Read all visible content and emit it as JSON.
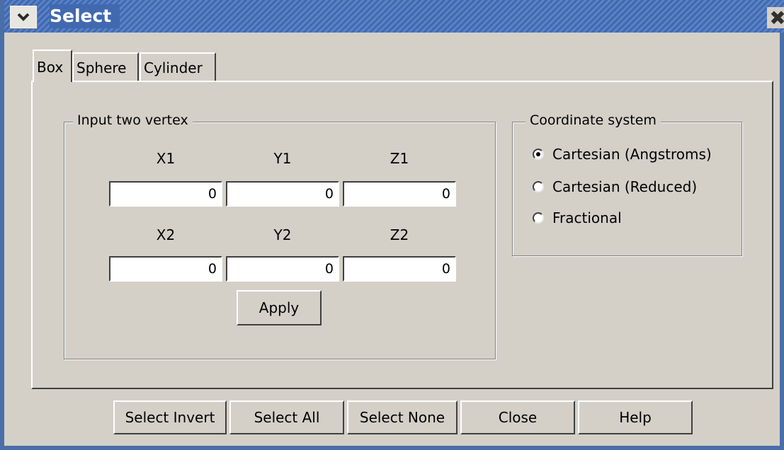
{
  "window": {
    "title": "Select",
    "menu_glyph": "❯",
    "close_glyph": "✖"
  },
  "tabs": [
    {
      "label": "Box",
      "active": true
    },
    {
      "label": "Sphere",
      "active": false
    },
    {
      "label": "Cylinder",
      "active": false
    }
  ],
  "vertex_group": {
    "legend": "Input two vertex",
    "row1_labels": [
      "X1",
      "Y1",
      "Z1"
    ],
    "row1_values": [
      "0",
      "0",
      "0"
    ],
    "row2_labels": [
      "X2",
      "Y2",
      "Z2"
    ],
    "row2_values": [
      "0",
      "0",
      "0"
    ],
    "apply_label": "Apply"
  },
  "coord_group": {
    "legend": "Coordinate system",
    "options": [
      {
        "label": "Cartesian (Angstroms)",
        "selected": true
      },
      {
        "label": "Cartesian (Reduced)",
        "selected": false
      },
      {
        "label": "Fractional",
        "selected": false
      }
    ]
  },
  "footer_buttons": [
    "Select Invert",
    "Select All",
    "Select None",
    "Close",
    "Help"
  ],
  "colors": {
    "titlebar": "#4169b0",
    "dialog_bg": "#d4d0c8"
  }
}
